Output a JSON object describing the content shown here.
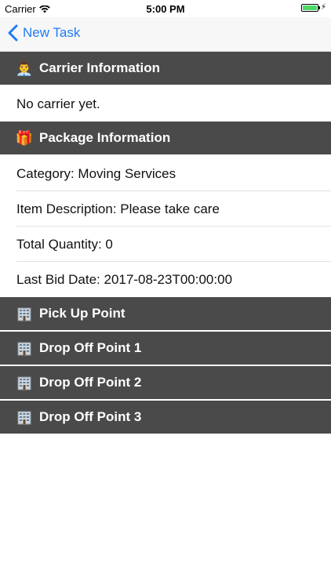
{
  "status_bar": {
    "carrier": "Carrier",
    "time": "5:00 PM",
    "battery_level": 1.0,
    "battery_color": "#4cd964"
  },
  "nav": {
    "back_label": "New Task",
    "accent": "#1e7cf4"
  },
  "sections": {
    "carrier": {
      "icon": "👨‍💼",
      "title": "Carrier Information"
    },
    "package": {
      "icon": "🎁",
      "title": "Package Information"
    },
    "pickup": {
      "icon": "building-icon",
      "title": "Pick Up Point"
    },
    "drop1": {
      "icon": "building-icon",
      "title": "Drop Off Point 1"
    },
    "drop2": {
      "icon": "building-icon",
      "title": "Drop Off Point 2"
    },
    "drop3": {
      "icon": "building-icon",
      "title": "Drop Off Point 3"
    }
  },
  "carrier_info": {
    "text": "No carrier yet."
  },
  "package_info": {
    "category": "Category: Moving Services",
    "description": "Item Description: Please take care",
    "quantity": "Total Quantity: 0",
    "last_bid": "Last Bid Date: 2017-08-23T00:00:00"
  },
  "colors": {
    "header_bg": "#4a4a4a",
    "header_text": "#ffffff"
  }
}
